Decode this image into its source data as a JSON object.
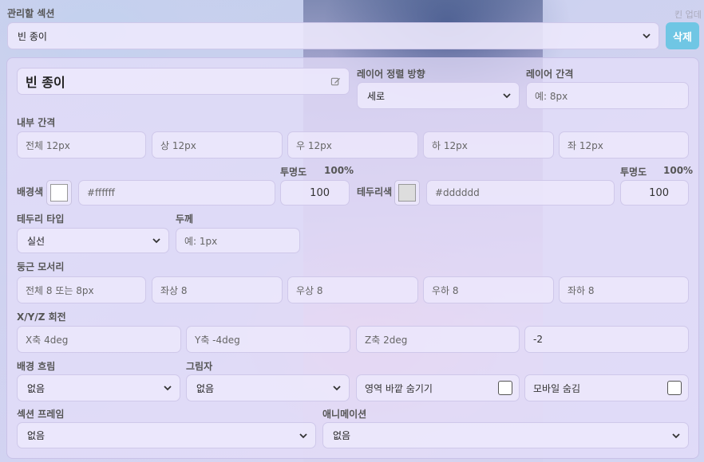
{
  "section": {
    "label": "관리할 섹션",
    "selected": "빈 종이",
    "delete_label": "삭제",
    "corner_hint": "킨 업데"
  },
  "title": {
    "value": "빈 종이",
    "edit_icon": "pencil-icon"
  },
  "layer_direction": {
    "label": "레이어 정렬 방향",
    "selected": "세로"
  },
  "layer_gap": {
    "label": "레이어 간격",
    "placeholder": "예: 8px"
  },
  "padding": {
    "label": "내부 간격",
    "all": "전체 12px",
    "top": "상 12px",
    "right": "우 12px",
    "bottom": "하 12px",
    "left": "좌 12px"
  },
  "background": {
    "label": "배경색",
    "swatch": "#ffffff",
    "value": "#ffffff",
    "opacity_label": "투명도",
    "opacity_percent": "100%",
    "opacity_value": "100"
  },
  "border_color": {
    "label": "테두리색",
    "swatch": "#dddddd",
    "value": "#dddddd",
    "opacity_label": "투명도",
    "opacity_percent": "100%",
    "opacity_value": "100"
  },
  "border_type": {
    "label": "테두리 타입",
    "selected": "실선"
  },
  "border_width": {
    "label": "두께",
    "placeholder": "예: 1px"
  },
  "radius": {
    "label": "둥근 모서리",
    "all": "전체 8 또는 8px",
    "tl": "좌상 8",
    "tr": "우상 8",
    "br": "우하 8",
    "bl": "좌하 8"
  },
  "rotation": {
    "label": "X/Y/Z 회전",
    "x": "X축 4deg",
    "y": "Y축 -4deg",
    "z": "Z축 2deg",
    "extra": "-2"
  },
  "bg_flow": {
    "label": "배경 흐림",
    "selected": "없음"
  },
  "shadow": {
    "label": "그림자",
    "selected": "없음"
  },
  "hide_overflow": {
    "label": "영역 바깥 숨기기"
  },
  "mobile_hide": {
    "label": "모바일 숨김"
  },
  "section_frame": {
    "label": "섹션 프레임",
    "selected": "없음"
  },
  "animation": {
    "label": "애니메이션",
    "selected": "없음"
  }
}
